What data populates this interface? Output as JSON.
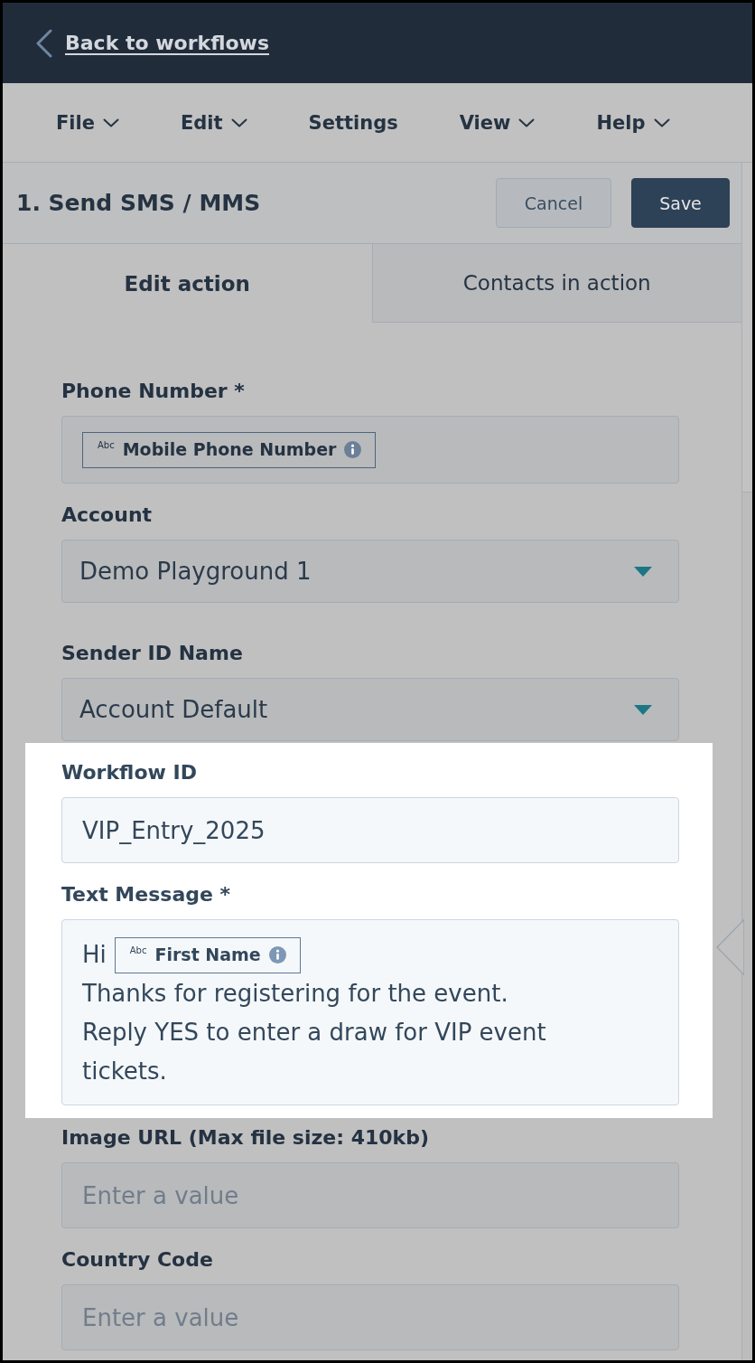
{
  "top_bar": {
    "back_link": "Back to workflows"
  },
  "menu": [
    {
      "label": "File",
      "dropdown": true
    },
    {
      "label": "Edit",
      "dropdown": true
    },
    {
      "label": "Settings",
      "dropdown": false
    },
    {
      "label": "View",
      "dropdown": true
    },
    {
      "label": "Help",
      "dropdown": true
    }
  ],
  "panel": {
    "title": "1. Send SMS / MMS",
    "buttons": [
      {
        "label": "Cancel",
        "kind": "secondary"
      },
      {
        "label": "Save",
        "kind": "primary"
      }
    ]
  },
  "tabs": [
    {
      "label": "Edit action",
      "selected": true
    },
    {
      "label": "Contacts in action",
      "selected": false
    }
  ],
  "form": {
    "groups": [
      {
        "highlighted": false,
        "fields": [
          {
            "kind": "token",
            "label": "Phone Number *",
            "token": {
              "type_label": "Abc",
              "label": "Mobile Phone Number"
            }
          },
          {
            "kind": "select",
            "label": "Account",
            "value": "Demo Playground 1"
          },
          {
            "kind": "select",
            "label": "Sender ID Name",
            "value": "Account Default"
          }
        ]
      },
      {
        "highlighted": true,
        "fields": [
          {
            "kind": "input",
            "label": "Workflow ID",
            "value": "VIP_Entry_2025"
          },
          {
            "kind": "message",
            "label": "Text Message *",
            "greeting": "Hi",
            "token": {
              "type_label": "Abc",
              "label": "First Name"
            },
            "lines": [
              "Thanks for registering for the event.",
              "Reply YES to enter a draw for VIP event",
              "tickets."
            ]
          }
        ]
      },
      {
        "highlighted": false,
        "fields": [
          {
            "kind": "input",
            "label": "Image URL (Max file size: 410kb)",
            "placeholder": "Enter a value"
          },
          {
            "kind": "input",
            "label": "Country Code",
            "placeholder": "Enter a value"
          }
        ]
      }
    ]
  }
}
